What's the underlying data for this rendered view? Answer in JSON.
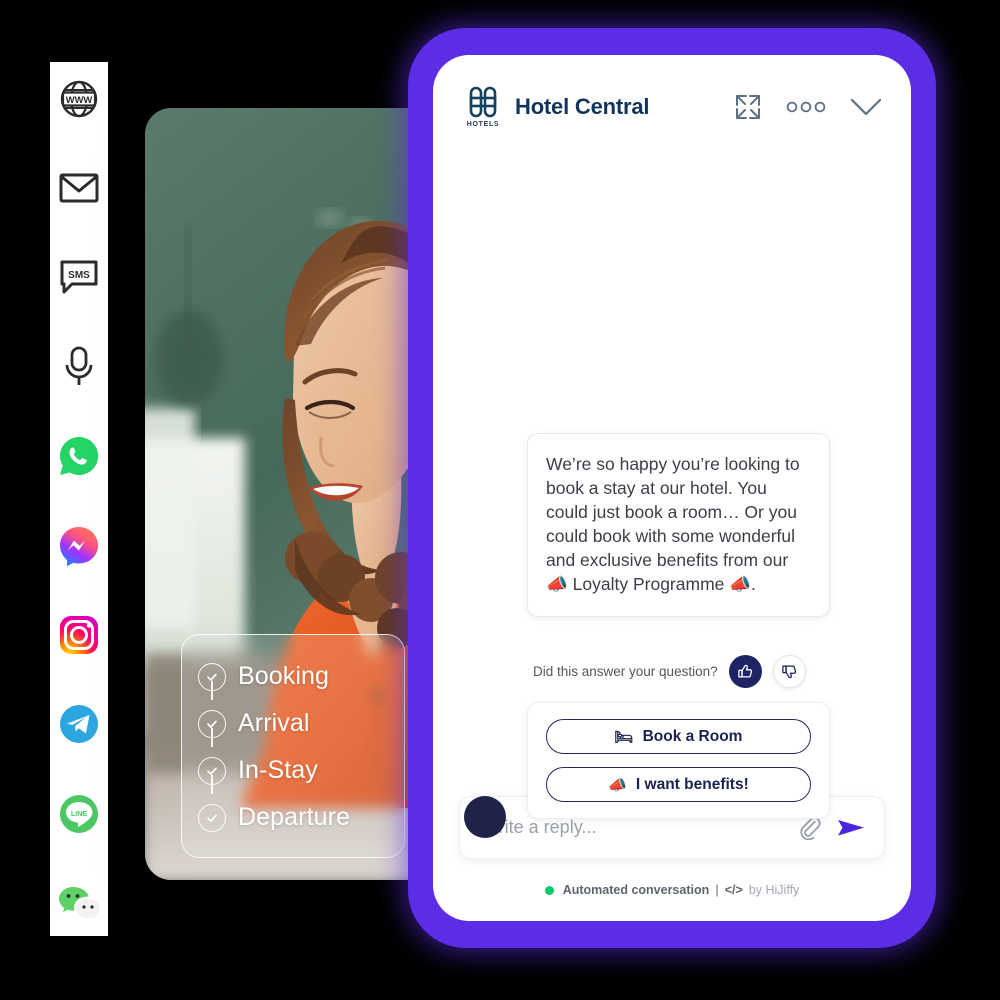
{
  "channel_rail": {
    "items": [
      {
        "name": "website-www-icon",
        "label": "WWW"
      },
      {
        "name": "email-icon",
        "label": "Email"
      },
      {
        "name": "sms-icon",
        "label": "SMS"
      },
      {
        "name": "voice-microphone-icon",
        "label": "Voice"
      },
      {
        "name": "whatsapp-icon",
        "label": "WhatsApp"
      },
      {
        "name": "facebook-messenger-icon",
        "label": "Messenger"
      },
      {
        "name": "instagram-icon",
        "label": "Instagram"
      },
      {
        "name": "telegram-icon",
        "label": "Telegram"
      },
      {
        "name": "line-icon",
        "label": "LINE"
      },
      {
        "name": "wechat-icon",
        "label": "WeChat"
      }
    ]
  },
  "photo_card": {
    "journey": {
      "steps": [
        {
          "label": "Booking"
        },
        {
          "label": "Arrival"
        },
        {
          "label": "In-Stay"
        },
        {
          "label": "Departure"
        }
      ]
    }
  },
  "chat": {
    "header": {
      "brand_title": "Hotel Central",
      "logo_caption": "HOTELS",
      "expand_icon": "expand-icon",
      "more_icon": "more-options-icon",
      "collapse_icon": "chevron-down-icon"
    },
    "message": {
      "text": "We’re so happy you’re looking to book a stay at our hotel. You could just book a room… Or you could book with some wonderful and exclusive benefits from our 📣 Loyalty Programme 📣."
    },
    "feedback": {
      "question": "Did this answer your question?",
      "thumbs_up_icon": "thumbs-up-icon",
      "thumbs_down_icon": "thumbs-down-icon"
    },
    "quick_replies": [
      {
        "emoji": "🛏",
        "label": "Book a Room"
      },
      {
        "emoji": "📣",
        "label": "I want benefits!"
      }
    ],
    "composer": {
      "placeholder": "Write a reply...",
      "value": "",
      "attach_icon": "paperclip-icon",
      "send_icon": "send-icon"
    },
    "footer": {
      "status": "Automated conversation",
      "separator": "|",
      "code_glyph": "</>",
      "credit": "by HiJiffy"
    }
  },
  "colors": {
    "brand_purple": "#5b2ee5",
    "navy": "#1e2364",
    "header_navy": "#11355a",
    "status_green": "#00cc66"
  }
}
